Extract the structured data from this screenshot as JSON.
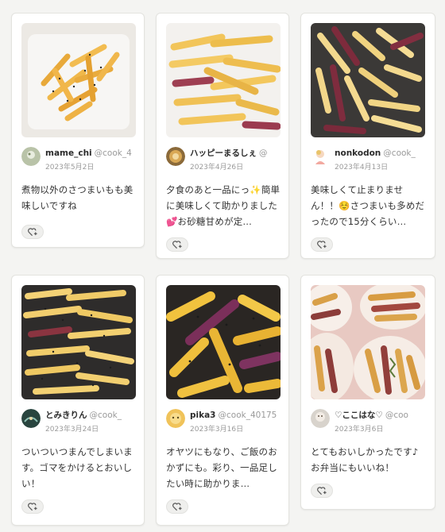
{
  "cards": [
    {
      "username": "mame_chi",
      "handle": "@cook_4",
      "date": "2023年5月2日",
      "comment": "煮物以外のさつまいもも美味しいですね",
      "photo_icon": "sweet-potato-fries-plate-photo",
      "avatar_icon": "user-avatar"
    },
    {
      "username": "ハッピーまるしぇ",
      "handle": "@",
      "date": "2023年4月26日",
      "comment": "夕食のあと一品にっ✨簡単に美味しくて助かりました💕お砂糖甘めが定…",
      "photo_icon": "sweet-potato-sticks-bowl-photo",
      "avatar_icon": "user-avatar"
    },
    {
      "username": "nonkodon",
      "handle": "@cook_",
      "date": "2023年4月13日",
      "comment": "美味しくて止まりません！！☺️さつまいも多めだったので15分くらい…",
      "photo_icon": "sweet-potato-sticks-tray-photo",
      "avatar_icon": "user-avatar"
    },
    {
      "username": "とみきりん",
      "handle": "@cook_",
      "date": "2023年3月24日",
      "comment": "ついついつまんでしまいます。ゴマをかけるとおいしい！",
      "photo_icon": "sweet-potato-sticks-sesame-photo",
      "avatar_icon": "user-avatar"
    },
    {
      "username": "pika3",
      "handle": "@cook_40175",
      "date": "2023年3月16日",
      "comment": "オヤツにもなり、ご飯のおかずにも。彩り、一品足したい時に助かりま…",
      "photo_icon": "sweet-potato-sticks-closeup-photo",
      "avatar_icon": "user-avatar"
    },
    {
      "username": "♡ここはな♡",
      "handle": "@coo",
      "date": "2023年3月6日",
      "comment": "とてもおいしかったです♪お弁当にもいいね！",
      "photo_icon": "sweet-potato-bento-cups-photo",
      "avatar_icon": "user-avatar"
    }
  ],
  "like_icon": "heart-plus-icon",
  "colors": {
    "background": "#f4f4f2",
    "card": "#ffffff",
    "text": "#333333",
    "muted": "#9a9a9a",
    "like_button_bg": "#efefed"
  }
}
